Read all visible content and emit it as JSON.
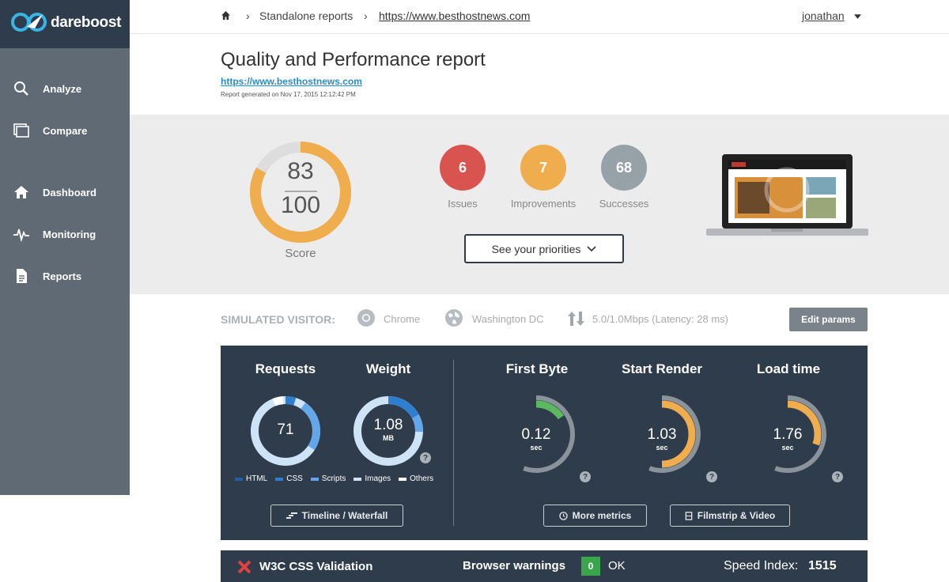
{
  "brand": {
    "name": "dareboost"
  },
  "sidebar": {
    "items": [
      {
        "label": "Analyze",
        "icon": "search-icon"
      },
      {
        "label": "Compare",
        "icon": "compare-icon"
      },
      {
        "label": "Dashboard",
        "icon": "home-icon"
      },
      {
        "label": "Monitoring",
        "icon": "pulse-icon"
      },
      {
        "label": "Reports",
        "icon": "document-icon"
      }
    ]
  },
  "breadcrumb": {
    "section": "Standalone reports",
    "url": "https://www.besthostnews.com"
  },
  "user": {
    "name": "jonathan"
  },
  "report": {
    "title": "Quality and Performance report",
    "url": "https://www.besthostnews.com",
    "generated": "Report generated on Nov 17, 2015 12:12:42 PM"
  },
  "score": {
    "value": "83",
    "max": "100",
    "label": "Score",
    "fraction": 0.83
  },
  "summary": [
    {
      "count": "6",
      "label": "Issues",
      "color": "#d9534f"
    },
    {
      "count": "7",
      "label": "Improvements",
      "color": "#f0ad4e"
    },
    {
      "count": "68",
      "label": "Successes",
      "color": "#97a1a8"
    }
  ],
  "priorities_label": "See your priorities",
  "visitor": {
    "heading": "SIMULATED VISITOR:",
    "browser": "Chrome",
    "location": "Washington DC",
    "connection": "5.0/1.0Mbps (Latency: 28 ms)",
    "edit_label": "Edit params"
  },
  "metrics": {
    "requests": {
      "title": "Requests",
      "value": "71"
    },
    "weight": {
      "title": "Weight",
      "value": "1.08",
      "unit": "MB"
    },
    "legend": [
      "HTML",
      "CSS",
      "Scripts",
      "Images",
      "Others"
    ],
    "first_byte": {
      "title": "First Byte",
      "value": "0.12",
      "unit": "sec",
      "fraction": 0.28,
      "color": "#5cb85c"
    },
    "start_render": {
      "title": "Start Render",
      "value": "1.03",
      "unit": "sec",
      "fraction": 0.9,
      "color": "#f0ad4e"
    },
    "load_time": {
      "title": "Load time",
      "value": "1.76",
      "unit": "sec",
      "fraction": 0.55,
      "color": "#f0ad4e"
    },
    "buttons": {
      "timeline": "Timeline / Waterfall",
      "more": "More metrics",
      "filmstrip": "Filmstrip & Video"
    }
  },
  "strip": {
    "w3c": "W3C CSS Validation",
    "browser_warnings": "Browser warnings",
    "warnings_count": "0",
    "warnings_status": "OK",
    "speed_label": "Speed Index:",
    "speed_value": "1515"
  },
  "colors": {
    "accent": "#f0ad4e",
    "navy": "#2f3c4b",
    "sidebar": "#5f6a74",
    "link": "#2a8cc8"
  }
}
